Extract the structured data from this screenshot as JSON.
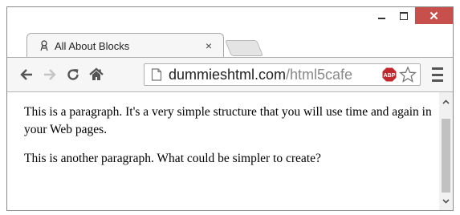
{
  "window": {
    "minimize_label": "minimize",
    "maximize_label": "maximize",
    "close_glyph": "✕"
  },
  "tab": {
    "title": "All About Blocks",
    "close_glyph": "×",
    "favicon": "dummies-favicon-icon"
  },
  "toolbar": {
    "back_icon": "back-arrow-icon",
    "forward_icon": "forward-arrow-icon",
    "reload_icon": "reload-icon",
    "home_icon": "home-icon",
    "menu_icon": "hamburger-menu-icon"
  },
  "omnibox": {
    "url_domain": "dummieshtml.com",
    "url_path": "/html5cafe",
    "page_icon": "page-icon",
    "extension_icon": "adblock-plus-icon",
    "extension_label": "ABP",
    "bookmark_icon": "star-icon"
  },
  "page": {
    "paragraphs": [
      "This is a paragraph. It's a very simple structure that you will use time and again in your Web pages.",
      "This is another paragraph. What could be simpler to create?"
    ]
  },
  "colors": {
    "close_button": "#c7504d",
    "toolbar_bg": "#f6f6f6",
    "scroll_thumb": "#c1c1c1",
    "url_path": "#888888"
  }
}
